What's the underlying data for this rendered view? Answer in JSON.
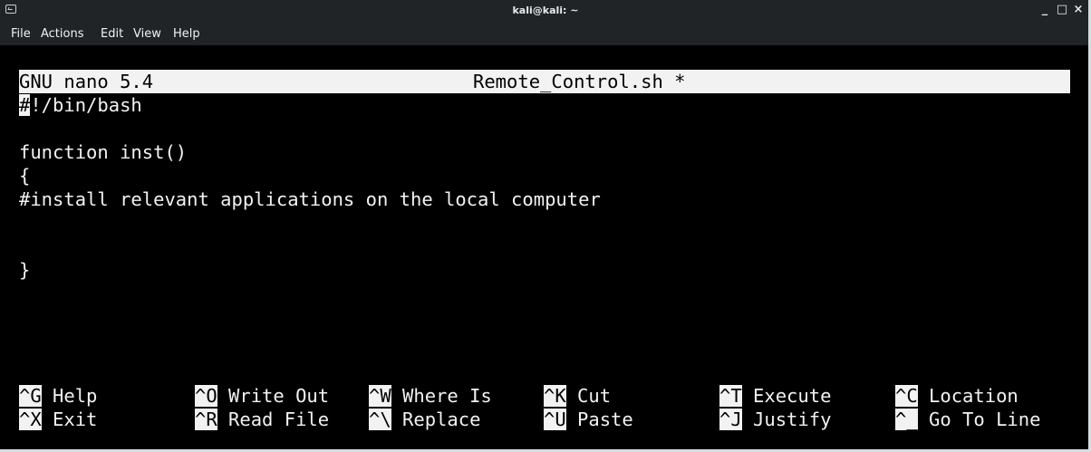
{
  "window": {
    "title": "kali@kali: ~",
    "controls": {
      "minimize": "_",
      "maximize": "□",
      "close": "×"
    }
  },
  "menu": [
    "File",
    "Actions",
    "Edit",
    "View",
    "Help"
  ],
  "nano": {
    "version": "GNU nano 5.4",
    "filename": "Remote_Control.sh *"
  },
  "editor": {
    "line1_cursor": "#",
    "line1_rest": "!/bin/bash",
    "line3": "function inst()",
    "line4": "{",
    "line5": "#install relevant applications on the local computer",
    "line8": "}"
  },
  "shortcuts": {
    "row1": [
      {
        "key": "^G",
        "label": "Help"
      },
      {
        "key": "^O",
        "label": "Write Out"
      },
      {
        "key": "^W",
        "label": "Where Is"
      },
      {
        "key": "^K",
        "label": "Cut"
      },
      {
        "key": "^T",
        "label": "Execute"
      },
      {
        "key": "^C",
        "label": "Location"
      }
    ],
    "row2": [
      {
        "key": "^X",
        "label": "Exit"
      },
      {
        "key": "^R",
        "label": "Read File"
      },
      {
        "key": "^\\",
        "label": "Replace"
      },
      {
        "key": "^U",
        "label": "Paste"
      },
      {
        "key": "^J",
        "label": "Justify"
      },
      {
        "key": "^_",
        "label": "Go To Line"
      }
    ]
  },
  "colors": {
    "terminal_bg": "#000000",
    "terminal_fg": "#f2f2f2",
    "titlebar_bg": "#202427"
  }
}
